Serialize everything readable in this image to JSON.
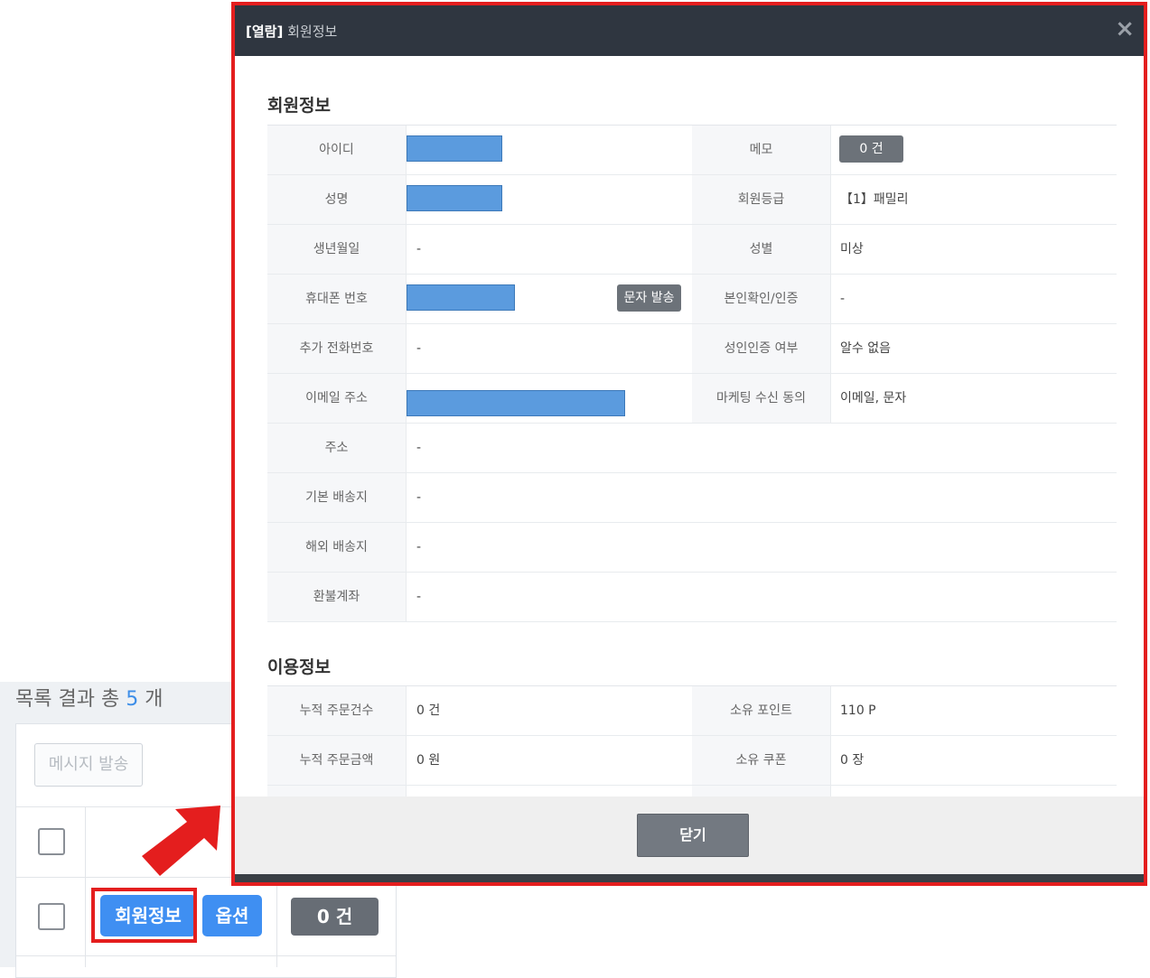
{
  "list": {
    "summary_prefix": "목록 결과 총",
    "count": "5",
    "summary_suffix": "개",
    "message_button": "메시지 발송",
    "member_info_button": "회원정보",
    "options_button": "옵션",
    "count_button": "0 건"
  },
  "modal": {
    "title_bold": "[열람]",
    "title": "회원정보",
    "close_icon": "×",
    "member_section_title": "회원정보",
    "member_rows": [
      {
        "label": "아이디",
        "value": "",
        "right_label": "메모",
        "right_value": "0 건"
      },
      {
        "label": "성명",
        "value": "",
        "right_label": "회원등급",
        "right_value": "【1】패밀리"
      },
      {
        "label": "생년월일",
        "value": "-",
        "right_label": "성별",
        "right_value": "미상"
      },
      {
        "label": "휴대폰 번호",
        "value": "",
        "right_label": "본인확인/인증",
        "right_value": "-"
      },
      {
        "label": "추가 전화번호",
        "value": "-",
        "right_label": "성인인증 여부",
        "right_value": "알수 없음"
      },
      {
        "label": "이메일 주소",
        "value": "",
        "right_label": "마케팅 수신 동의",
        "right_value": "이메일, 문자"
      },
      {
        "label": "주소",
        "value": "-"
      },
      {
        "label": "기본 배송지",
        "value": "-"
      },
      {
        "label": "해외 배송지",
        "value": "-"
      },
      {
        "label": "환불계좌",
        "value": "-"
      }
    ],
    "sms_button": "문자 발송",
    "usage_section_title": "이용정보",
    "usage_rows": [
      {
        "label": "누적 주문건수",
        "value": "0 건",
        "right_label": "소유 포인트",
        "right_value": "110 P"
      },
      {
        "label": "누적 주문금액",
        "value": "0 원",
        "right_label": "소유 쿠폰",
        "right_value": "0 장"
      }
    ],
    "close_button": "닫기"
  },
  "colors": {
    "highlight": "#e41e1e",
    "primary_button": "#3f8ff2",
    "header": "#2f3640",
    "redaction": "#5b9bde"
  }
}
